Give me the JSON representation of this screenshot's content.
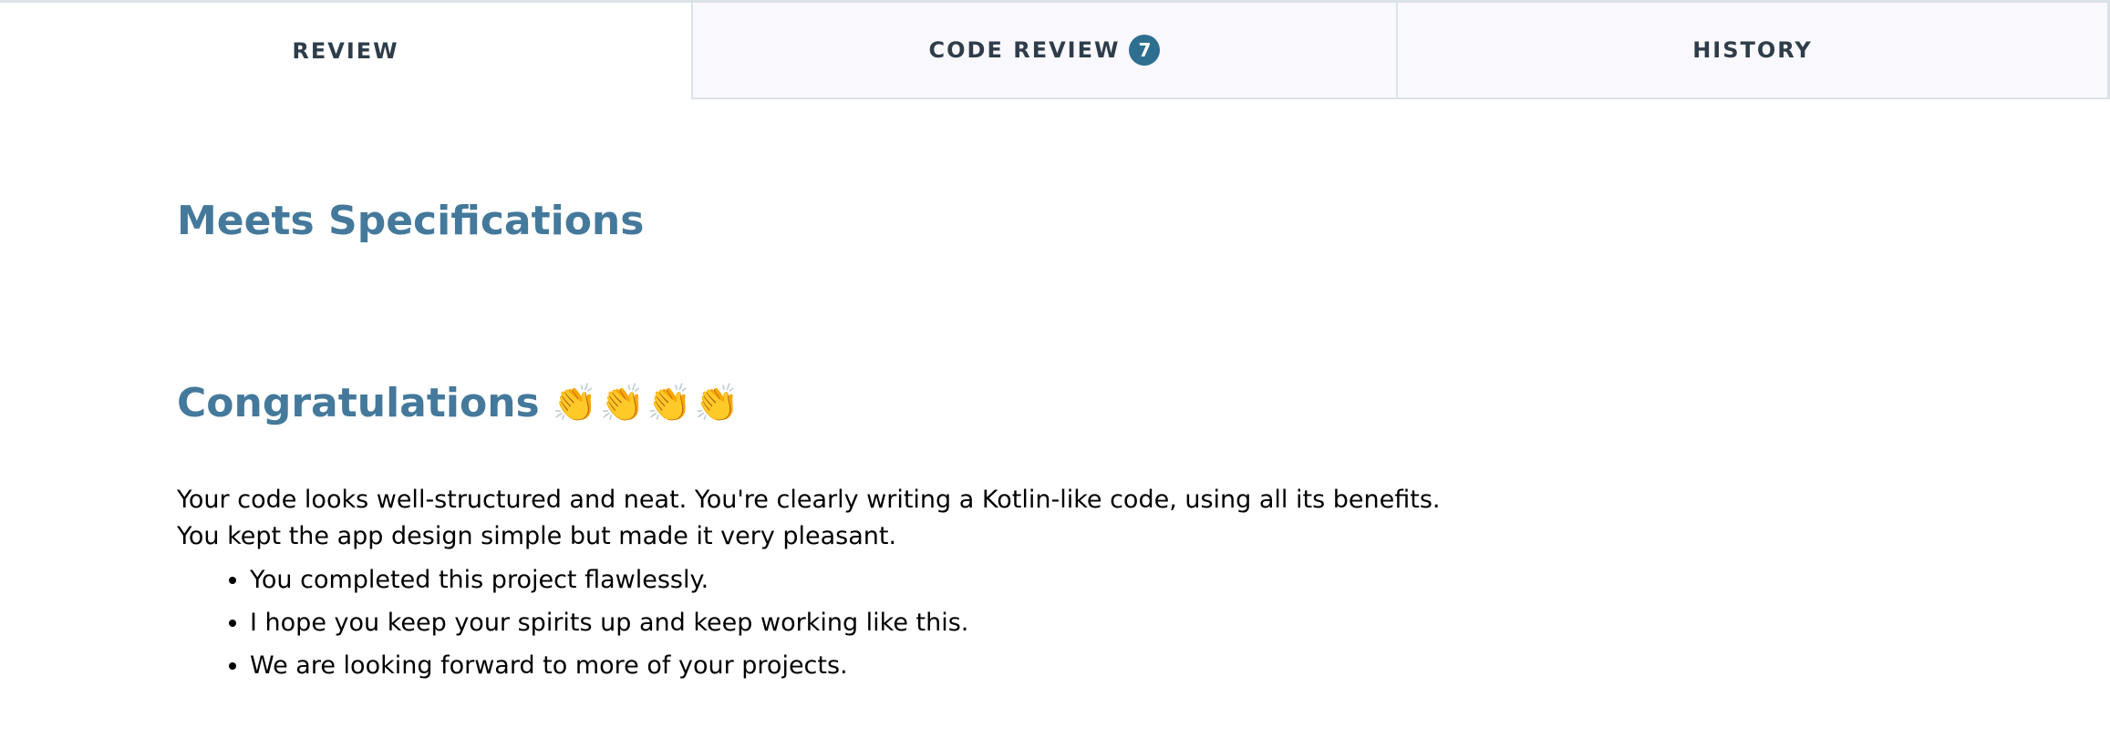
{
  "tabs": {
    "review": "REVIEW",
    "code_review": "CODE REVIEW",
    "code_review_count": "7",
    "history": "HISTORY"
  },
  "review": {
    "spec_heading": "Meets Specifications",
    "congrats_heading": "Congratulations",
    "congrats_icons": [
      "clapping-hands-icon",
      "clapping-hands-icon",
      "clapping-hands-icon",
      "clapping-hands-icon"
    ],
    "paragraph_lines": [
      "Your code looks well-structured and neat. You're clearly writing a Kotlin-like code, using all its benefits.",
      "You kept the app design simple but made it very pleasant."
    ],
    "bullets": [
      "You completed this project flawlessly.",
      "I hope you keep your spirits up and keep working like this.",
      "We are looking forward to more of your projects."
    ]
  },
  "colors": {
    "heading": "#44799b",
    "badge": "#2e6f90",
    "tab_inactive_bg": "#f9f8fd",
    "tab_border": "#dbe2e8"
  }
}
